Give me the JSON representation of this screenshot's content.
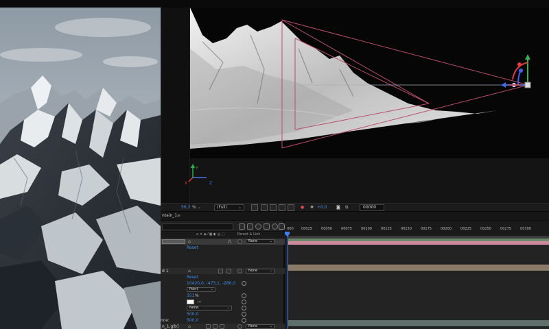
{
  "viewer": {
    "zoom_value": "56,3",
    "zoom_unit": "%",
    "resolution": "(Full)",
    "exposure": "+0,0",
    "timecode": "00000",
    "axis_y": "Y",
    "axis_z": "Z",
    "axis_x": "X"
  },
  "timeline": {
    "tab_label": "ntain_1",
    "tab_menu": "≡",
    "header_parent_link": "Parent & Link",
    "ruler_start": "000",
    "ruler_ticks": [
      "00025",
      "00050",
      "00075",
      "00100",
      "00125",
      "00150",
      "00175",
      "00200",
      "00225",
      "00250",
      "00275",
      "00300"
    ],
    "rows": [
      {
        "parent": "None",
        "reset": "Reset"
      },
      {
        "name": "d 1",
        "parent": "None",
        "reset": "Reset",
        "position": "10420,0, -473,1, -280,0",
        "point_of_interest": "Point",
        "scale": "351",
        "scale_unit": "%",
        "flag": "None",
        "v1": "500,0",
        "prop_label": "nce:",
        "v2": "500,0"
      },
      {
        "name": "n_1.glb]",
        "parent": "None",
        "reset": "Reset",
        "bottom": "0,0, 0,0, 0,0"
      }
    ]
  },
  "colors": {
    "accent": "#3f8ee8",
    "track_green": "#6c8a6b",
    "track_pink": "#d08a9d",
    "track_tan": "#8c7a68",
    "track_teal": "#5d6e6b",
    "camera_pink": "#b94f6a"
  }
}
